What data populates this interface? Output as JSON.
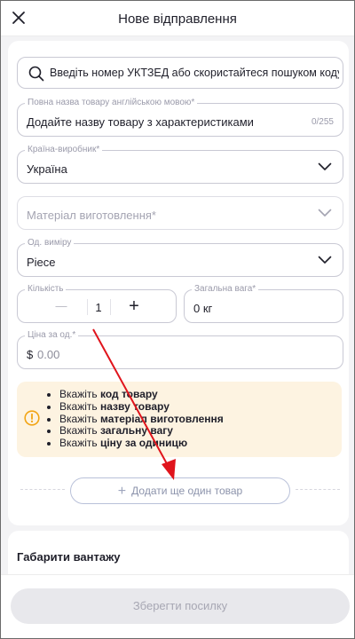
{
  "header": {
    "title": "Нове відправлення"
  },
  "search": {
    "placeholder": "Введіть номер УКТЗЕД або скористайтеся пошуком коду по ..."
  },
  "fields": {
    "name": {
      "label": "Повна назва товару англійською мовою*",
      "placeholder": "Додайте назву товару з характеристиками",
      "counter": "0/255"
    },
    "country": {
      "label": "Країна-виробник*",
      "value": "Україна"
    },
    "material": {
      "placeholder": "Матеріал виготовлення*"
    },
    "unit": {
      "label": "Од. виміру",
      "value": "Piece"
    },
    "quantity": {
      "label": "Кількість",
      "value": "1",
      "minus": "—",
      "plus": "+"
    },
    "weight": {
      "label": "Загальна вага*",
      "value": "0 кг"
    },
    "price": {
      "label": "Ціна за од.*",
      "currency": "$",
      "placeholder": "0.00"
    }
  },
  "warning": {
    "items": [
      {
        "prefix": "Вкажіть ",
        "bold": "код товару"
      },
      {
        "prefix": "Вкажіть ",
        "bold": "назву товару"
      },
      {
        "prefix": "Вкажіть ",
        "bold": "матеріал виготовлення"
      },
      {
        "prefix": "Вкажіть ",
        "bold": "загальну вагу"
      },
      {
        "prefix": "Вкажіть ",
        "bold": "ціну за одиницю"
      }
    ]
  },
  "add_button": {
    "label": "Додати ще один товар",
    "icon": "plus-icon"
  },
  "dimensions_section": {
    "title": "Габарити вантажу"
  },
  "footer": {
    "save_label": "Зберегти посилку"
  },
  "colors": {
    "accent_border": "#c9c9d4",
    "warning_bg": "#fdf3e1",
    "warning_icon": "#f2a413",
    "annotation_arrow": "#e0141c",
    "disabled_button": "#e8e8ec"
  }
}
